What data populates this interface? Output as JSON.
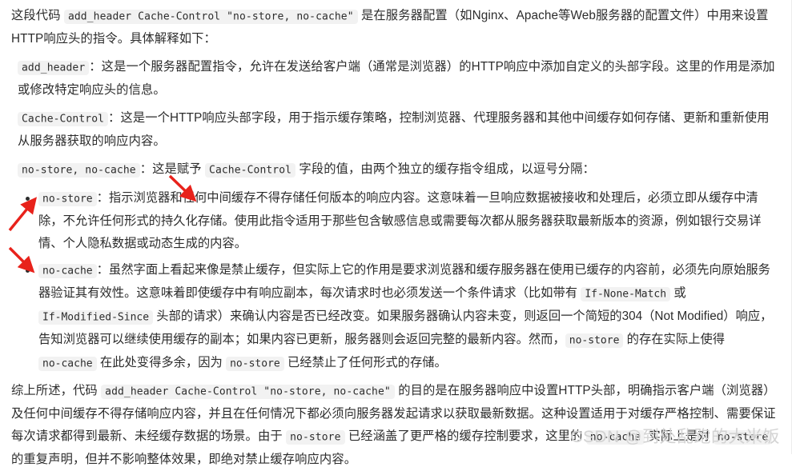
{
  "document": {
    "intro": {
      "before_code": "这段代码 ",
      "code": "add_header Cache-Control \"no-store, no-cache\"",
      "after_code": " 是在服务器配置（如Nginx、Apache等Web服务器的配置文件）中用来设置HTTP响应头的指令。具体解释如下："
    },
    "definitions": [
      {
        "term": "add_header",
        "text": "：这是一个服务器配置指令，允许在发送给客户端（通常是浏览器）的HTTP响应中添加自定义的头部字段。这里的作用是添加或修改特定响应头的信息。"
      },
      {
        "term": "Cache-Control",
        "text": "：这是一个HTTP响应头部字段，用于指示缓存策略，控制浏览器、代理服务器和其他中间缓存如何存储、更新和重新使用从服务器获取的响应内容。"
      }
    ],
    "value_line": {
      "term": "no-store, no-cache",
      "mid_before": "：这是赋予 ",
      "inline_code": "Cache-Control",
      "mid_after": " 字段的值，由两个独立的缓存指令组成，以逗号分隔："
    },
    "bullets": [
      {
        "term": "no-store",
        "text": "：指示浏览器和任何中间缓存不得存储任何版本的响应内容。这意味着一旦响应数据被接收和处理后，必须立即从缓存中清除，不允许任何形式的持久化存储。使用此指令适用于那些包含敏感信息或需要每次都从服务器获取最新版本的资源，例如银行交易详情、个人隐私数据或动态生成的内容。"
      },
      {
        "term": "no-cache",
        "segments": {
          "s1": "：虽然字面上看起来像是禁止缓存，但实际上它的作用是要求浏览器和缓存服务器在使用已缓存的内容前，必须先向原始服务器验证其有效性。这意味着即使缓存中有响应副本，每次请求时也必须发送一个条件请求（比如带有 ",
          "c1": "If-None-Match",
          "s2": " 或 ",
          "c2": "If-Modified-Since",
          "s3": " 头部的请求）来确认内容是否已经改变。如果服务器确认内容未变，则返回一个简短的304（Not Modified）响应，告知浏览器可以继续使用缓存的副本；如果内容已更新，服务器则会返回完整的最新内容。然而，",
          "c3": "no-store",
          "s4": " 的存在实际上使得 ",
          "c4": "no-cache",
          "s5": " 在此处变得多余，因为 ",
          "c5": "no-store",
          "s6": " 已经禁止了任何形式的存储。"
        }
      }
    ],
    "summary": {
      "s1": "综上所述，代码 ",
      "c1": "add_header Cache-Control \"no-store, no-cache\"",
      "s2": " 的目的是在服务器响应中设置HTTP头部，明确指示客户端（浏览器）及任何中间缓存不得存储响应内容，并且在任何情况下都必须向服务器发起请求以获取最新数据。这种设置适用于对缓存严格控制、需要保证每次请求都得到最新、未经缓存数据的场景。由于 ",
      "c2": "no-store",
      "s3": " 已经涵盖了更严格的缓存控制要求，这里的 ",
      "c3": "no-cache",
      "s4": " 实际上是对 ",
      "c4": "no-store",
      "s5": " 的重复声明，但并不影响整体效果，即绝对禁止缓存响应内容。"
    }
  },
  "annotations": {
    "color": "#e8221b",
    "arrows": [
      {
        "name": "arrow-to-no-store-term",
        "label": "points up-right at the no-store code token"
      },
      {
        "name": "arrow-to-no-cache-term",
        "label": "points down-right at the no-cache code token"
      },
      {
        "name": "arrow-to-must-not-store-phrase",
        "label": "points down-right at 不得存储 phrase"
      }
    ]
  },
  "watermark": {
    "text": "CSDN @到处乱跑的大米饭",
    "color": "#d3d3d3"
  }
}
